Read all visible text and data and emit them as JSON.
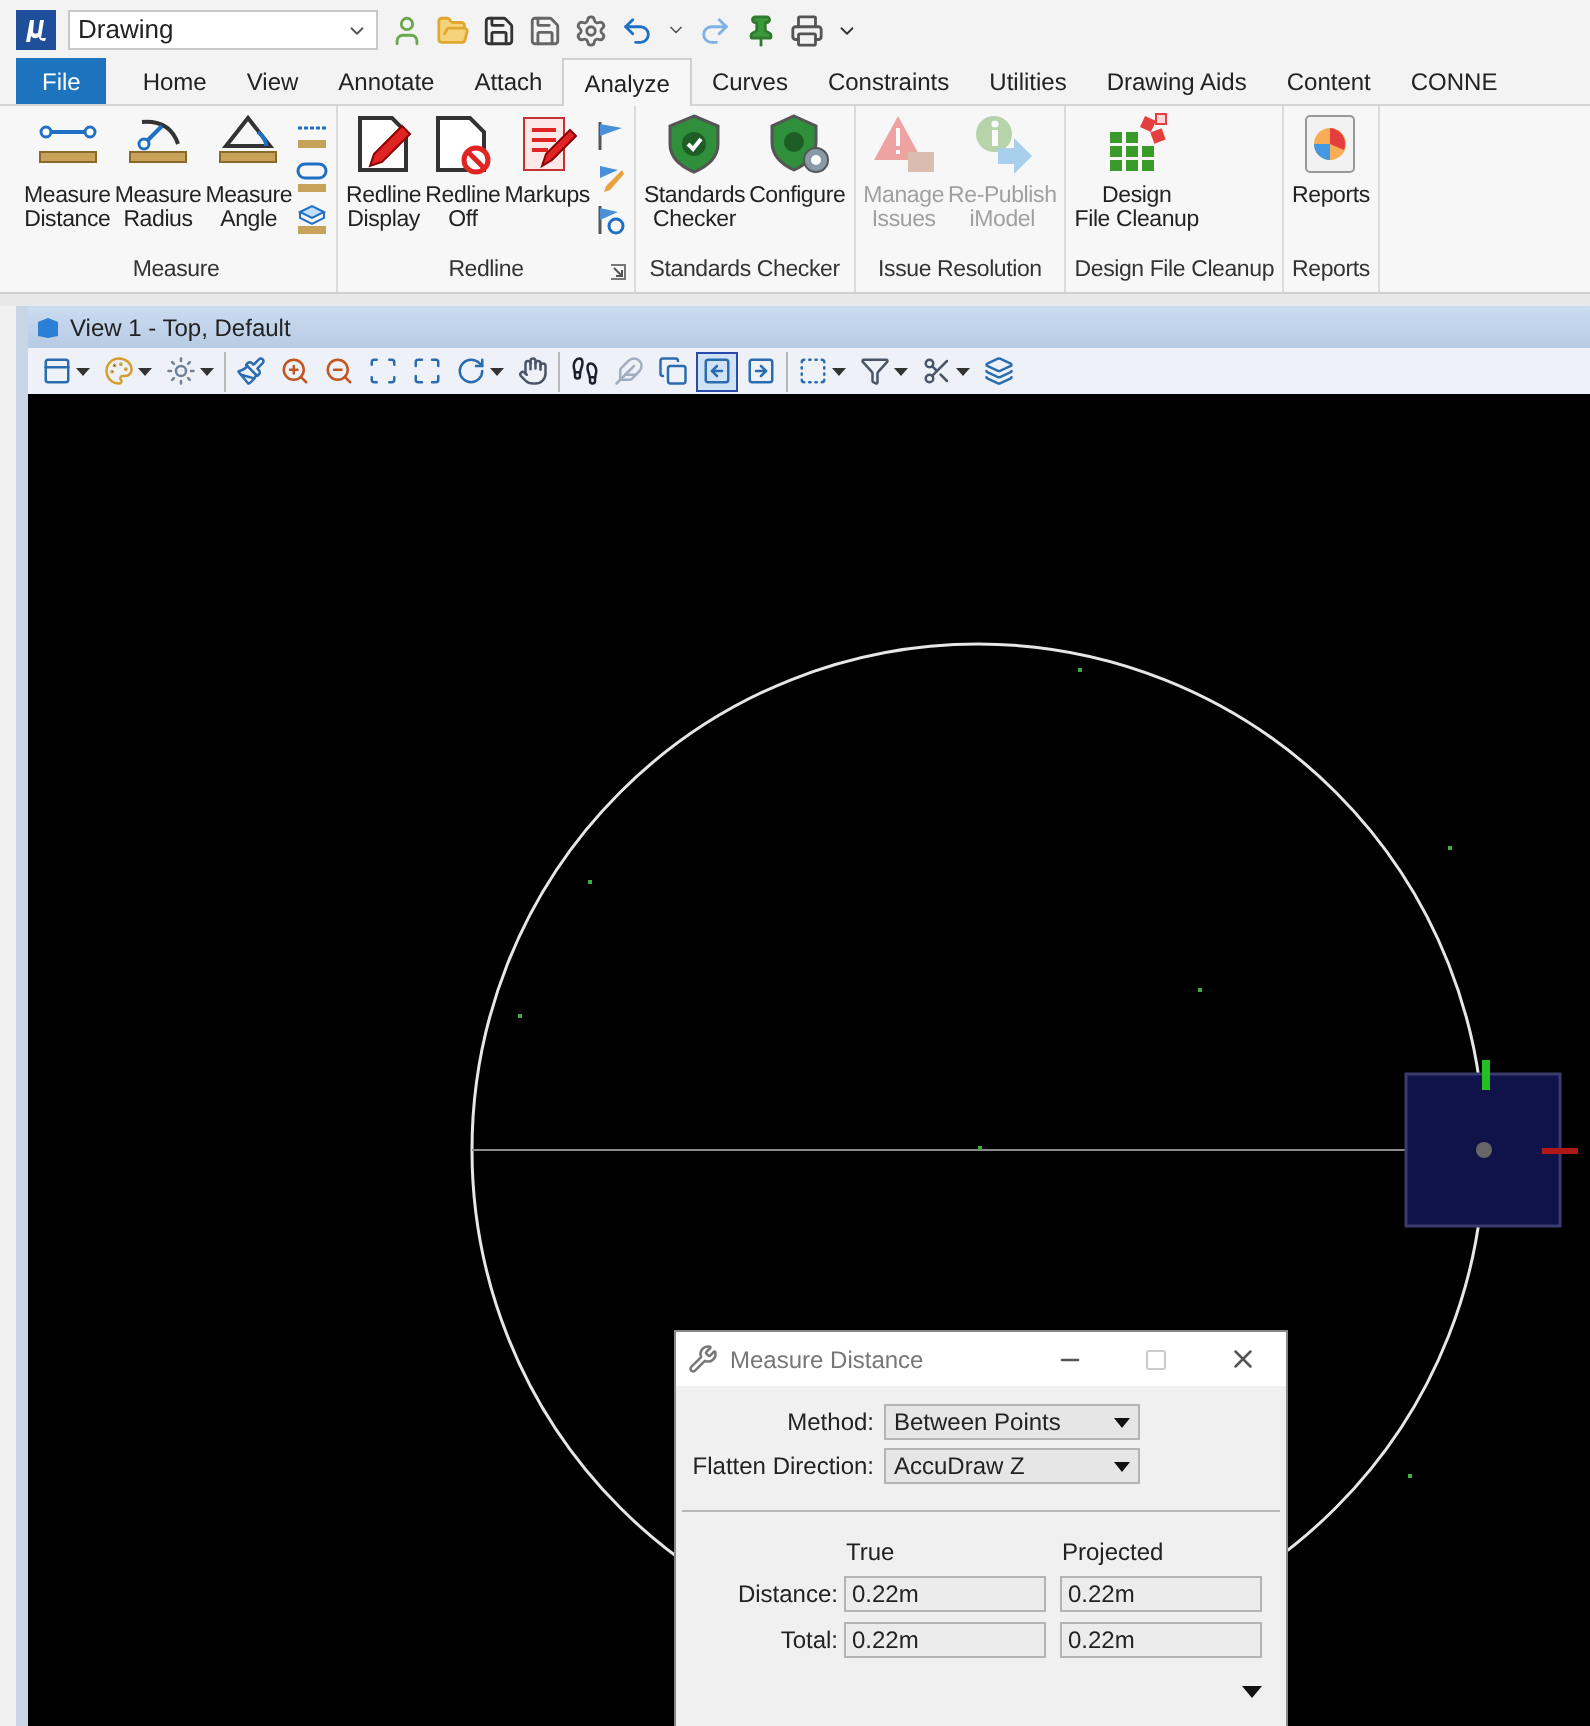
{
  "quick_access": {
    "workflow": "Drawing"
  },
  "tabs": [
    {
      "label": "File",
      "kind": "file",
      "selected": false
    },
    {
      "label": "Home",
      "kind": "tab",
      "selected": false
    },
    {
      "label": "View",
      "kind": "tab",
      "selected": false
    },
    {
      "label": "Annotate",
      "kind": "tab",
      "selected": false
    },
    {
      "label": "Attach",
      "kind": "tab",
      "selected": false
    },
    {
      "label": "Analyze",
      "kind": "tab",
      "selected": true
    },
    {
      "label": "Curves",
      "kind": "tab",
      "selected": false
    },
    {
      "label": "Constraints",
      "kind": "tab",
      "selected": false
    },
    {
      "label": "Utilities",
      "kind": "tab",
      "selected": false
    },
    {
      "label": "Drawing Aids",
      "kind": "tab",
      "selected": false
    },
    {
      "label": "Content",
      "kind": "tab",
      "selected": false
    },
    {
      "label": "CONNE",
      "kind": "tab",
      "selected": false
    }
  ],
  "ribbon_groups": [
    {
      "label": "Measure",
      "kind": "measure-tools",
      "launcher": false,
      "buttons": [
        {
          "lines": [
            "Measure",
            "Distance"
          ],
          "kind": "distance",
          "disabled": false
        },
        {
          "lines": [
            "Measure",
            "Radius"
          ],
          "kind": "radius",
          "disabled": false
        },
        {
          "lines": [
            "Measure",
            "Angle"
          ],
          "kind": "angle",
          "disabled": false
        }
      ]
    },
    {
      "label": "Redline",
      "kind": "redline-tools",
      "launcher": true,
      "buttons": [
        {
          "lines": [
            "Redline",
            "Display"
          ],
          "kind": "redline-display",
          "disabled": false
        },
        {
          "lines": [
            "Redline",
            "Off"
          ],
          "kind": "redline-off",
          "disabled": false
        },
        {
          "lines": [
            "Markups"
          ],
          "kind": "markups",
          "disabled": false
        }
      ]
    },
    {
      "label": "Standards Checker",
      "kind": "plain",
      "launcher": false,
      "buttons": [
        {
          "lines": [
            "Standards",
            "Checker"
          ],
          "kind": "shield",
          "disabled": false
        },
        {
          "lines": [
            "Configure"
          ],
          "kind": "shield-gear",
          "disabled": false
        }
      ]
    },
    {
      "label": "Issue Resolution",
      "kind": "plain",
      "launcher": false,
      "buttons": [
        {
          "lines": [
            "Manage",
            "Issues"
          ],
          "kind": "issues",
          "disabled": true
        },
        {
          "lines": [
            "Re-Publish",
            "iModel"
          ],
          "kind": "republish",
          "disabled": true
        }
      ]
    },
    {
      "label": "Design File Cleanup",
      "kind": "plain",
      "launcher": false,
      "buttons": [
        {
          "lines": [
            "Design",
            "File Cleanup"
          ],
          "kind": "cleanup",
          "disabled": false
        }
      ]
    },
    {
      "label": "Reports",
      "kind": "plain",
      "launcher": false,
      "buttons": [
        {
          "lines": [
            "Reports"
          ],
          "kind": "reports",
          "disabled": false
        }
      ]
    }
  ],
  "view": {
    "title": "View 1 - Top, Default",
    "toolbar_groups": [
      [
        {
          "kind": "view-attributes",
          "dropdown": true,
          "selected": false
        },
        {
          "kind": "display-style",
          "dropdown": true,
          "selected": false
        },
        {
          "kind": "lights",
          "dropdown": true,
          "selected": false
        }
      ],
      [
        {
          "kind": "update",
          "dropdown": false,
          "selected": false
        },
        {
          "kind": "zoom-in",
          "dropdown": false,
          "selected": false
        },
        {
          "kind": "zoom-out",
          "dropdown": false,
          "selected": false
        },
        {
          "kind": "window-area",
          "dropdown": false,
          "selected": false
        },
        {
          "kind": "fit",
          "dropdown": false,
          "selected": false
        },
        {
          "kind": "rotate",
          "dropdown": true,
          "selected": false
        },
        {
          "kind": "pan",
          "dropdown": false,
          "selected": false
        }
      ],
      [
        {
          "kind": "walk",
          "dropdown": false,
          "selected": false
        },
        {
          "kind": "fly",
          "dropdown": false,
          "selected": false
        },
        {
          "kind": "copy-view",
          "dropdown": false,
          "selected": false
        },
        {
          "kind": "previous",
          "dropdown": false,
          "selected": true
        },
        {
          "kind": "next",
          "dropdown": false,
          "selected": false
        }
      ],
      [
        {
          "kind": "clip-volume",
          "dropdown": true,
          "selected": false
        },
        {
          "kind": "filter",
          "dropdown": true,
          "selected": false
        },
        {
          "kind": "cut",
          "dropdown": true,
          "selected": false
        },
        {
          "kind": "clip-mask",
          "dropdown": false,
          "selected": false
        }
      ]
    ]
  },
  "dialog": {
    "title": "Measure Distance",
    "options": [
      {
        "label": "Method:",
        "value": "Between Points"
      },
      {
        "label": "Flatten Direction:",
        "value": "AccuDraw Z"
      }
    ],
    "columns": [
      "True",
      "Projected"
    ],
    "rows": [
      {
        "label": "Distance:",
        "values": [
          "0.22m",
          "0.22m"
        ]
      },
      {
        "label": "Total:",
        "values": [
          "0.22m",
          "0.22m"
        ]
      }
    ]
  }
}
